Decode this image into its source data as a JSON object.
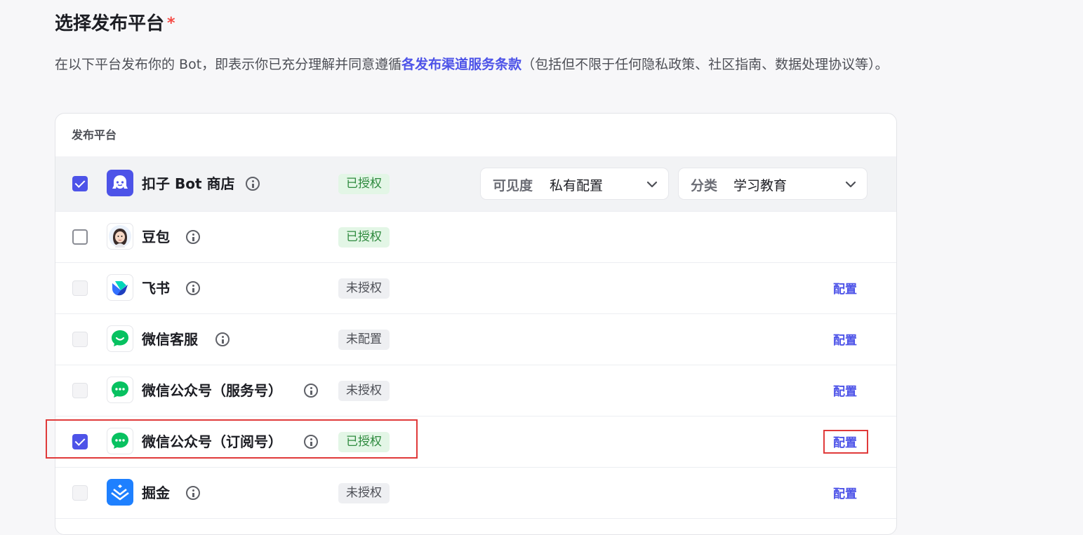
{
  "section": {
    "title": "选择发布平台",
    "required_mark": "*",
    "desc_prefix": "在以下平台发布你的 Bot，即表示你已充分理解并同意遵循",
    "desc_link": "各发布渠道服务条款",
    "desc_suffix": "（包括但不限于任何隐私政策、社区指南、数据处理协议等）。"
  },
  "table": {
    "header": "发布平台",
    "config_label": "配置",
    "rows": [
      {
        "name": "扣子 Bot 商店",
        "status": "已授权",
        "status_type": "ok",
        "checked": "checked",
        "icon": "coze-store-icon"
      },
      {
        "name": "豆包",
        "status": "已授权",
        "status_type": "ok",
        "checked": "unchecked",
        "icon": "doubao-avatar-icon"
      },
      {
        "name": "飞书",
        "status": "未授权",
        "status_type": "no",
        "checked": "disabled",
        "icon": "feishu-icon"
      },
      {
        "name": "微信客服",
        "status": "未配置",
        "status_type": "no",
        "checked": "disabled",
        "icon": "wechat-service-icon"
      },
      {
        "name": "微信公众号（服务号）",
        "status": "未授权",
        "status_type": "no",
        "checked": "disabled",
        "icon": "wechat-icon"
      },
      {
        "name": "微信公众号（订阅号）",
        "status": "已授权",
        "status_type": "ok",
        "checked": "checked",
        "icon": "wechat-icon"
      },
      {
        "name": "掘金",
        "status": "未授权",
        "status_type": "no",
        "checked": "disabled",
        "icon": "juejin-icon"
      }
    ],
    "visibility": {
      "label": "可见度",
      "value": "私有配置"
    },
    "category": {
      "label": "分类",
      "value": "学习教育"
    }
  },
  "colors": {
    "accent": "#4d53e8",
    "authorized_bg": "#e3f6e6",
    "authorized_text": "#2e8a3e",
    "highlight_border": "#e03a3a"
  }
}
